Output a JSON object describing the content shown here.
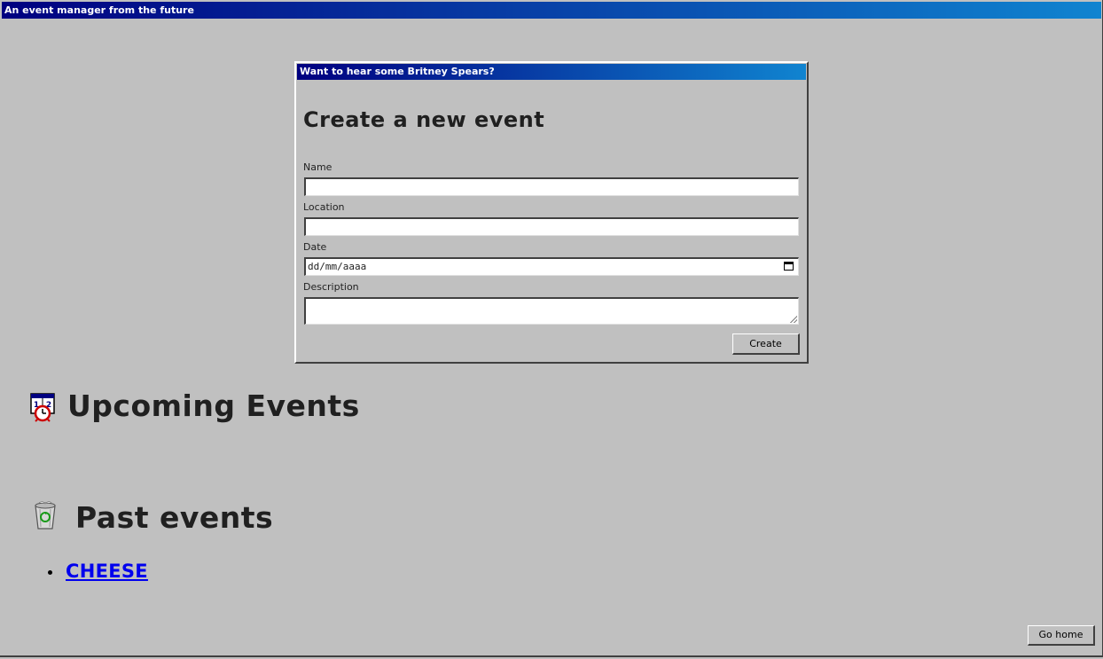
{
  "window": {
    "title": "An event manager from the future"
  },
  "dialog": {
    "title": "Want to hear some Britney Spears?",
    "heading": "Create a new event",
    "fields": {
      "name": {
        "label": "Name",
        "value": ""
      },
      "location": {
        "label": "Location",
        "value": ""
      },
      "date": {
        "label": "Date",
        "placeholder": "dd/mm/aaaa"
      },
      "description": {
        "label": "Description",
        "value": ""
      }
    },
    "create_label": "Create"
  },
  "upcoming": {
    "heading": "Upcoming Events",
    "icon": "calendar-clock-icon",
    "items": []
  },
  "past": {
    "heading": "Past events",
    "icon": "recycle-bin-icon",
    "items": [
      {
        "label": "CHEESE"
      }
    ]
  },
  "footer": {
    "home_label": "Go home"
  },
  "colors": {
    "titlebar_start": "#000080",
    "titlebar_end": "#1084d0",
    "window_bg": "#c0c0c0",
    "link": "#0000ee"
  }
}
